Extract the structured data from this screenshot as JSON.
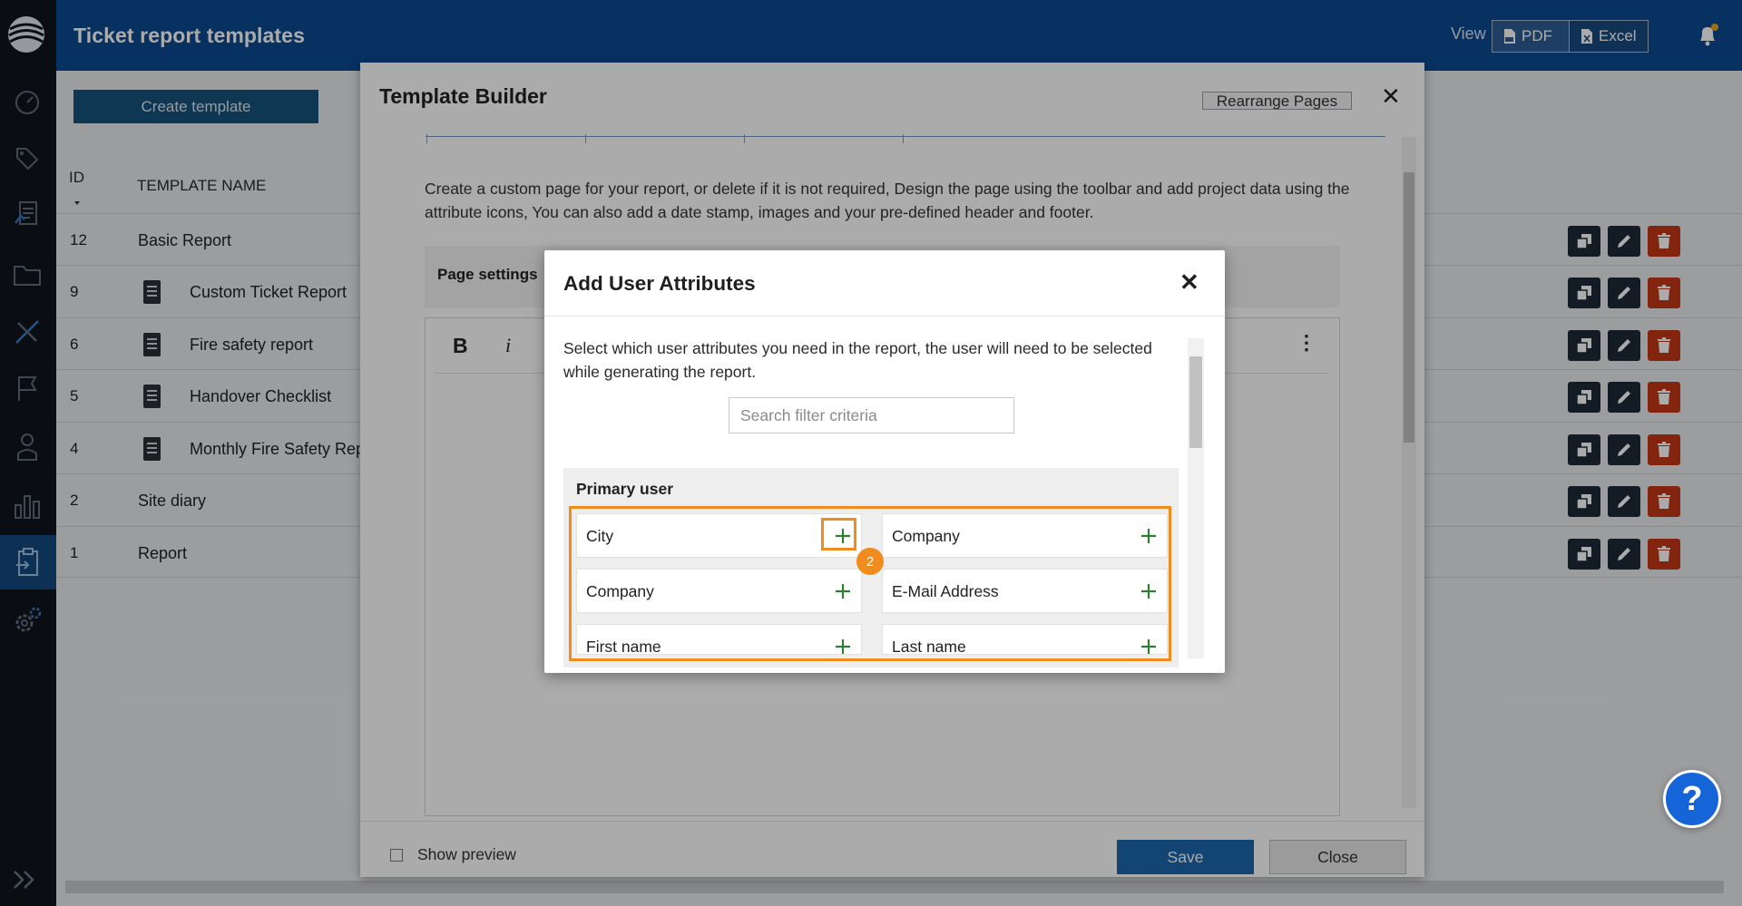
{
  "app": {
    "page_title": "Ticket report templates",
    "view_label": "View",
    "view_pdf": "PDF",
    "view_excel": "Excel"
  },
  "sidebar": {
    "items": [
      {
        "icon": "dashboard-icon"
      },
      {
        "icon": "tag-icon"
      },
      {
        "icon": "tickets-icon"
      },
      {
        "icon": "folder-icon"
      },
      {
        "icon": "tools-icon"
      },
      {
        "icon": "flag-icon"
      },
      {
        "icon": "user-icon"
      },
      {
        "icon": "chart-icon"
      },
      {
        "icon": "report-templates-icon",
        "active": true
      },
      {
        "icon": "settings-icon"
      }
    ]
  },
  "toolbar": {
    "create_template": "Create template"
  },
  "table": {
    "headers": {
      "id": "ID",
      "name": "TEMPLATE NAME"
    },
    "rows": [
      {
        "id": "12",
        "name": "Basic Report",
        "has_doc_icon": false
      },
      {
        "id": "9",
        "name": "Custom Ticket Report",
        "has_doc_icon": true
      },
      {
        "id": "6",
        "name": "Fire safety report",
        "has_doc_icon": true
      },
      {
        "id": "5",
        "name": "Handover Checklist",
        "has_doc_icon": true
      },
      {
        "id": "4",
        "name": "Monthly Fire Safety Repo",
        "has_doc_icon": true
      },
      {
        "id": "2",
        "name": "Site diary",
        "has_doc_icon": false
      },
      {
        "id": "1",
        "name": "Report",
        "has_doc_icon": false
      }
    ]
  },
  "template_builder": {
    "title": "Template Builder",
    "rearrange_pages": "Rearrange Pages",
    "description": "Create a custom page for your report, or delete if it is not required, Design the page using the toolbar and add project data using the attribute icons, You can also add a date stamp, images and your pre-defined header and footer.",
    "page_settings": "Page settings",
    "editor_bold": "B",
    "editor_italic": "i",
    "show_preview": "Show preview",
    "save": "Save",
    "close": "Close"
  },
  "add_user_attributes": {
    "title": "Add User Attributes",
    "instructions": "Select which user attributes you need in the report, the user will need to be selected while generating the report.",
    "search_placeholder": "Search filter criteria",
    "section_title": "Primary user",
    "attributes": [
      {
        "label": "City"
      },
      {
        "label": "Company"
      },
      {
        "label": "Company"
      },
      {
        "label": "E-Mail Address"
      },
      {
        "label": "First name"
      },
      {
        "label": "Last name"
      }
    ]
  },
  "annotation": {
    "step_number": "2",
    "highlight_color": "#f08c1e"
  },
  "colors": {
    "header_blue": "#0b4a8f",
    "sidebar_dark": "#10151d",
    "save_blue": "#1b66ad",
    "delete_red": "#c23616",
    "plus_green": "#2e7d32"
  }
}
